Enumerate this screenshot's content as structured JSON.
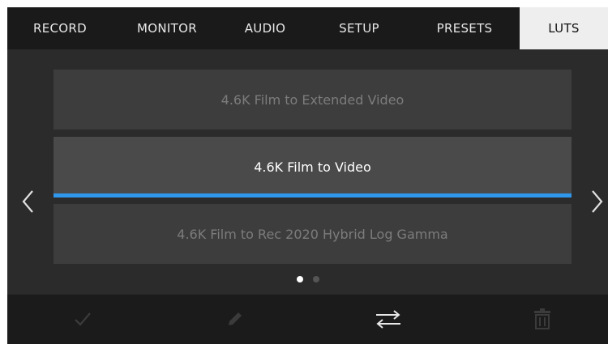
{
  "tabs": [
    {
      "label": "RECORD",
      "active": false
    },
    {
      "label": "MONITOR",
      "active": false
    },
    {
      "label": "AUDIO",
      "active": false
    },
    {
      "label": "SETUP",
      "active": false
    },
    {
      "label": "PRESETS",
      "active": false
    },
    {
      "label": "LUTS",
      "active": true
    }
  ],
  "luts": [
    {
      "name": "4.6K Film to Extended Video",
      "selected": false
    },
    {
      "name": "4.6K Film to Video",
      "selected": true
    },
    {
      "name": "4.6K Film to Rec 2020 Hybrid Log Gamma",
      "selected": false
    }
  ],
  "pagination": {
    "current": 1,
    "total": 2
  },
  "toolbar": {
    "icons": [
      "check-icon",
      "pencil-icon",
      "swap-arrows-icon",
      "trash-icon"
    ]
  },
  "colors": {
    "accent": "#2f97ec",
    "background": "#2b2b2b",
    "tab_active_bg": "#eeeeee"
  }
}
